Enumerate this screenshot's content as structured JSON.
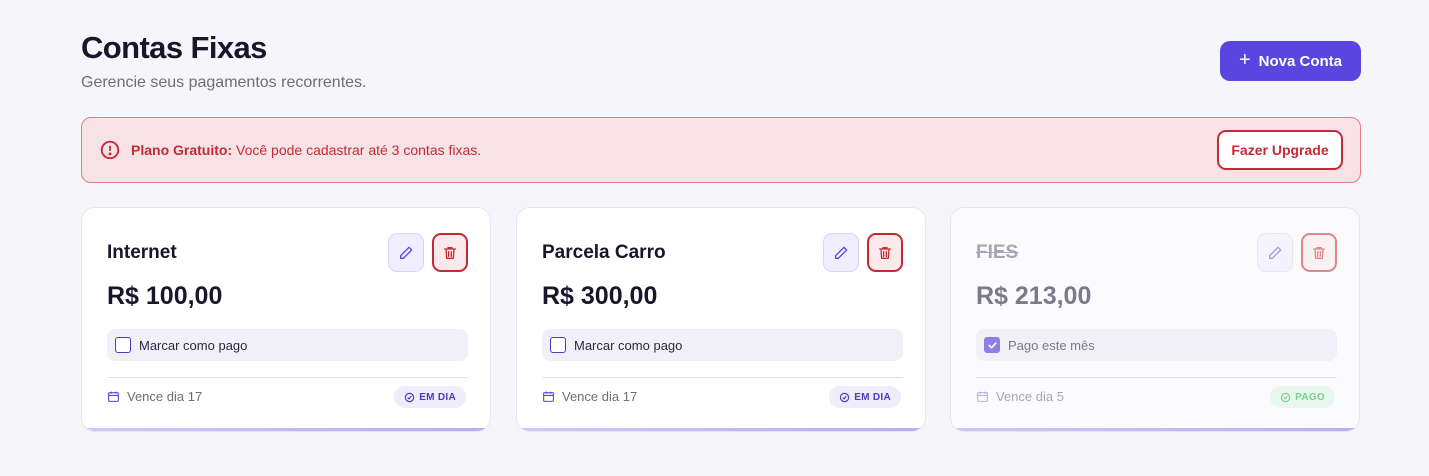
{
  "header": {
    "title": "Contas Fixas",
    "subtitle": "Gerencie seus pagamentos recorrentes.",
    "new_button": "Nova Conta",
    "new_button_icon": "plus-icon"
  },
  "banner": {
    "icon": "alert-circle-icon",
    "strong": "Plano Gratuito:",
    "text": " Você pode cadastrar até 3 contas fixas.",
    "upgrade_button": "Fazer Upgrade"
  },
  "cards": [
    {
      "name": "Internet",
      "amount": "R$ 100,00",
      "check_label": "Marcar como pago",
      "checked": false,
      "due": "Vence dia 17",
      "status": "EM DIA"
    },
    {
      "name": "Parcela Carro",
      "amount": "R$ 300,00",
      "check_label": "Marcar como pago",
      "checked": false,
      "due": "Vence dia 17",
      "status": "EM DIA"
    },
    {
      "name": "FIES",
      "amount": "R$ 213,00",
      "check_label": "Pago este mês",
      "checked": true,
      "due": "Vence dia 5",
      "status": "PAGO"
    }
  ],
  "colors": {
    "accent": "#5b45e0",
    "danger": "#c42a36",
    "banner_bg": "#f7e3e6",
    "paid_green": "#7ccf92"
  }
}
